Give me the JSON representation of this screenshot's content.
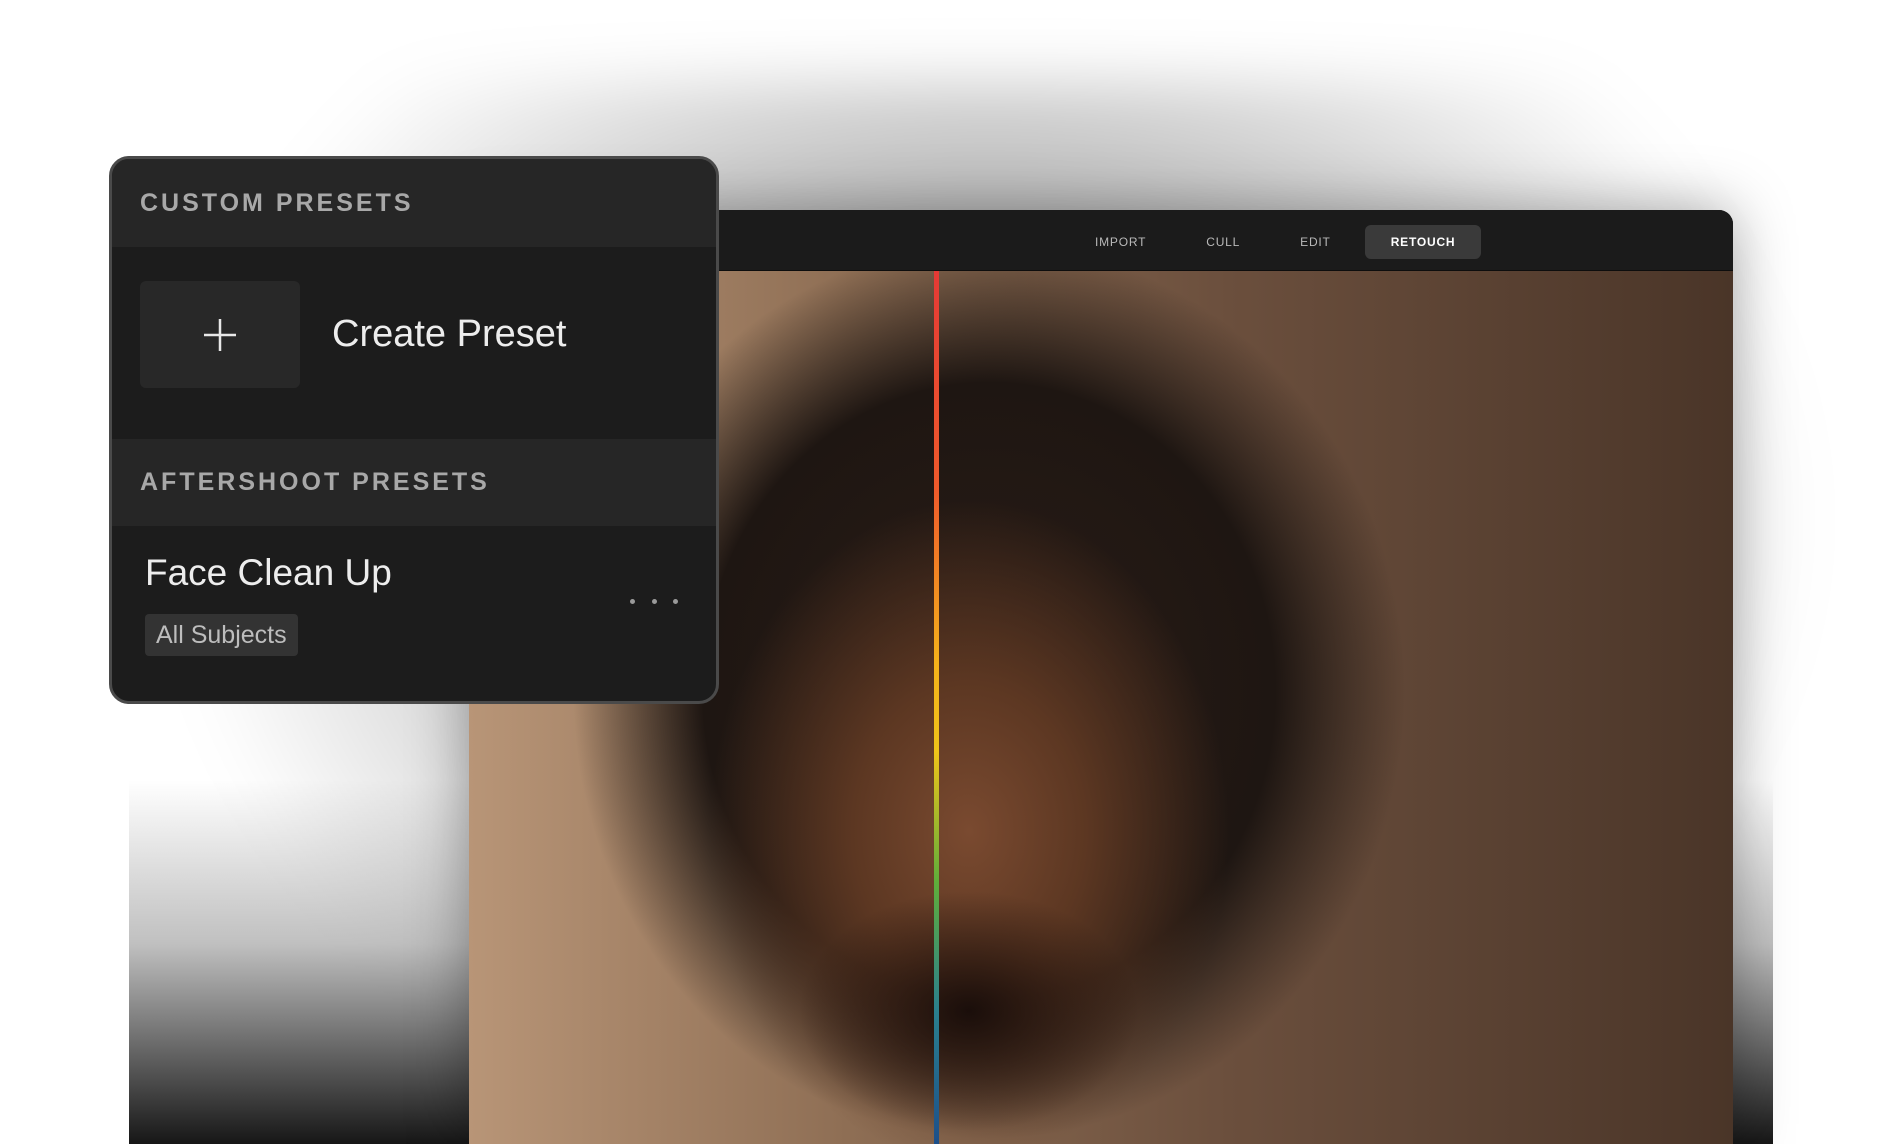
{
  "app_nav": {
    "tabs": [
      {
        "label": "IMPORT",
        "active": false
      },
      {
        "label": "CULL",
        "active": false
      },
      {
        "label": "EDIT",
        "active": false
      },
      {
        "label": "RETOUCH",
        "active": true
      }
    ]
  },
  "presets_panel": {
    "custom_section": {
      "title": "CUSTOM PRESETS",
      "create_label": "Create Preset",
      "create_icon": "plus-icon"
    },
    "aftershoot_section": {
      "title": "AFTERSHOOT PRESETS",
      "items": [
        {
          "name": "Face Clean Up",
          "tag": "All Subjects",
          "menu_icon": "more-horizontal-icon"
        }
      ]
    }
  },
  "colors": {
    "panel_bg": "#1c1c1c",
    "header_bg": "#262626",
    "active_tab_bg": "#3a3a3a",
    "split_line_gradient": [
      "#e53935",
      "#f5b21a",
      "#5fae3a",
      "#1c4f8a"
    ]
  }
}
